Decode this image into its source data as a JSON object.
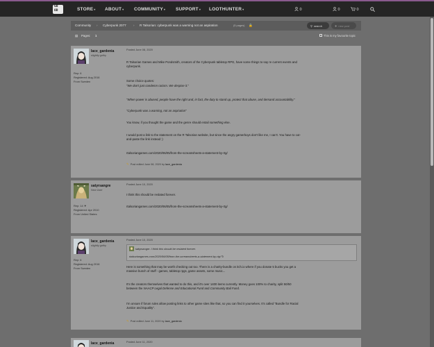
{
  "nav": {
    "logo_top": "GO",
    "logo_bottom": "OD",
    "items": [
      {
        "label": "STORE"
      },
      {
        "label": "ABOUT"
      },
      {
        "label": "COMMUNITY"
      },
      {
        "label": "SUPPORT"
      },
      {
        "label": "LOOTHUNTER"
      }
    ],
    "friends_count": "0",
    "user_count": "0",
    "cart_count": "0"
  },
  "breadcrumb": {
    "items": [
      "Community",
      "Cyberpunk 2077",
      "R Talsorian: cyberpunk was a warning not an aspiration"
    ],
    "pages_count": "(5 pages)",
    "search_label": "search",
    "new_post_label": "new post"
  },
  "pager": {
    "label": "Pages:",
    "current": "1",
    "favourite": "This is my favourite topic"
  },
  "posts": [
    {
      "username": "lace_gardenia",
      "rank": "slightly gothy",
      "rep": "Rep: 6",
      "registered": "Registered: Aug 2016",
      "from": "From Sweden",
      "posted": "Posted June 08, 2020",
      "p1": "R Talsorian Games and Mike Pondsmith, creators of the Cyberpunk tabletop RPG, have some things to say re current events and",
      "p1b": "cyberpunk.",
      "p2": "Some choice quotes:",
      "q1": "\"We don't just condemn racism. We despise it.\"",
      "q2": "\"When power is abused, people have the right and, in fact, the duty to stand up, protect that abuse, and demand accountability.\"",
      "q3": "\"Cyberpunk was a warning, not an aspiration\"",
      "p3_pre": "You know, if you thought the game and the genre should entail",
      "p3_it": "something",
      "p3_post": "else.",
      "p4": "I would post a link to the statement on the R Talsorian website, but since the angry gamerboys don't like me, I can't. You have to cut-",
      "p4b": "and-paste the link instead :)",
      "link": "rtalsoriangames.com/2020/06/05/from-the-screamsheets-a-statement-by-rtg/",
      "edited_pre": "Post edited June 08, 2020 by",
      "edited_by": "lace_gardenia"
    },
    {
      "username": "satyrsangre",
      "rank": "New User",
      "rep": "Rep: 14 ▼",
      "registered": "Registered: Apr 2010",
      "from": "From United States",
      "posted": "Posted June 10, 2020",
      "p1": "I think this should be reslated forever.",
      "link": "rtalsoriangames.com/2020/06/05/from-the-screamsheets-a-statement-by-rtg/"
    },
    {
      "username": "lace_gardenia",
      "rank": "slightly gothy",
      "rep": "Rep: 6",
      "registered": "Registered: Aug 2016",
      "from": "From Sweden",
      "posted": "Posted June 10, 2020",
      "quote_author": "satyrsangre:",
      "quote_text": "I think this should be reslated forever.",
      "quote_link": "rtalsoriangames.com/2020/06/05/from-the-screamsheets-a-statement-by-rtg/",
      "p1": "Here is something that may be worth checking out too. There is a charity-bundle on itch.io where if you donate 5 bucks you get a",
      "p1b": "massive bunch of stuff - games, tabletop rpgs, game assets, some music...",
      "p2": "It's the creators themselves that wanted to do this, and it's over 1400 items currently. Money goes 100% to charity, split 50/50",
      "p2b_pre": "between the",
      "p2b_it1": "NAACP Legal Defense and Educational Fund",
      "p2b_mid": "and",
      "p2b_it2": "Community Bail Fund",
      "p2b_end": ".",
      "p3": "I'm unsure if forum rules allow posting links to other game sites like that, so you can find it yourselves. It's called \"Bundle for Racial",
      "p3b": "Justice and Equality\".",
      "edited_pre": "Post edited June 11, 2020 by",
      "edited_by": "lace_gardenia"
    },
    {
      "username": "lace_gardenia",
      "posted": "Posted June 11, 2020"
    }
  ],
  "colors": {
    "navbar": "#252525",
    "top_strip": "#8a5a8f",
    "post_bg": "#9c9c9c",
    "page_bg": "#6e6e6e"
  }
}
